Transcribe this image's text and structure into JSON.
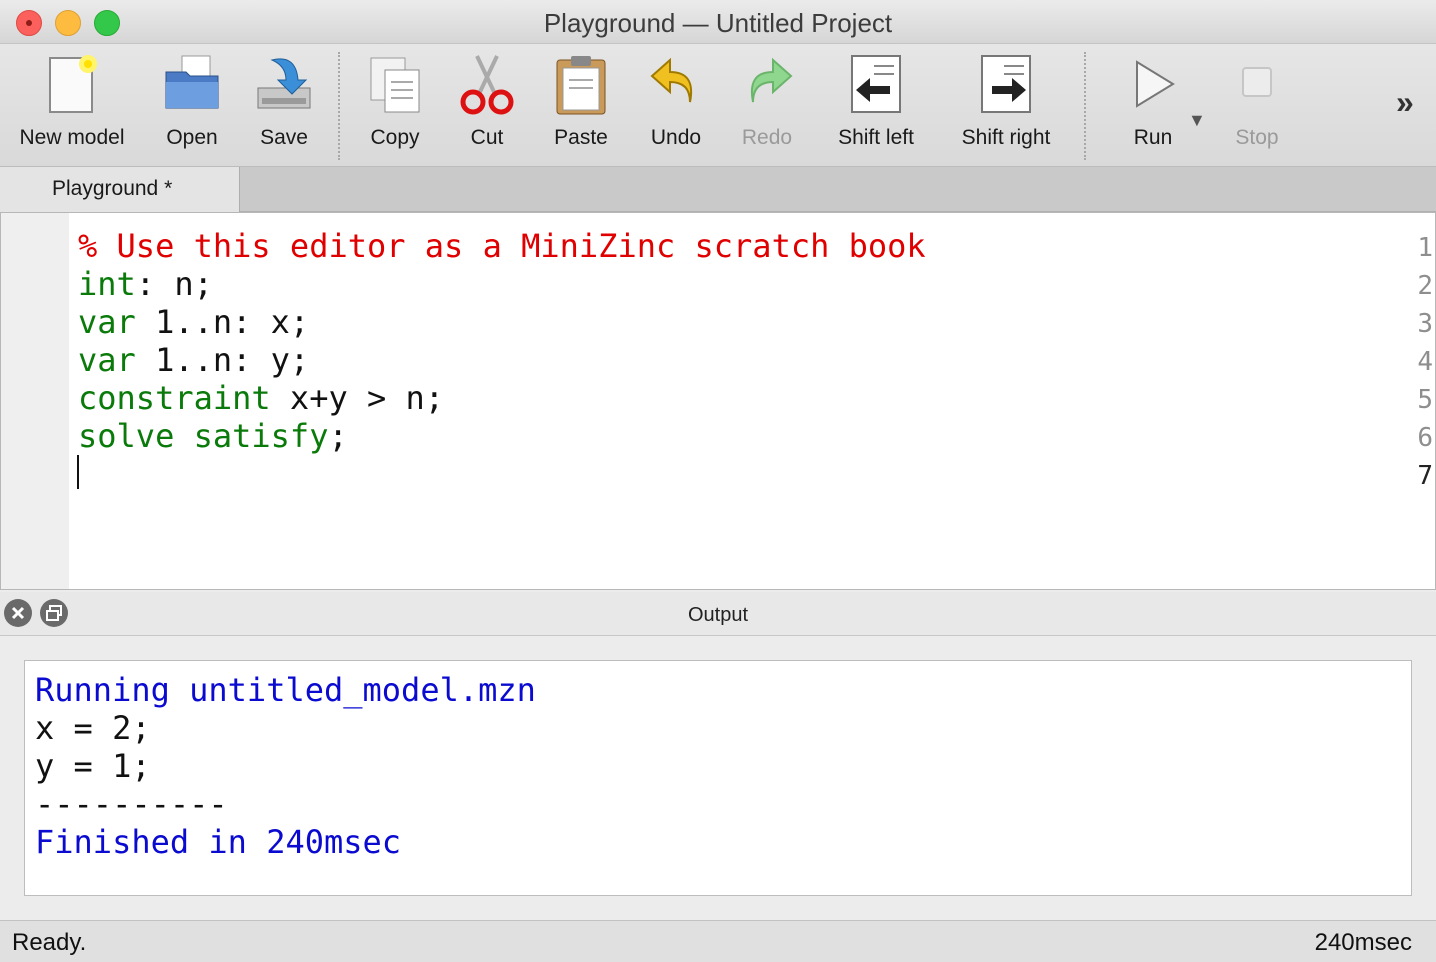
{
  "window": {
    "title": "Playground — Untitled Project"
  },
  "toolbar": {
    "new_model": "New model",
    "open": "Open",
    "save": "Save",
    "copy": "Copy",
    "cut": "Cut",
    "paste": "Paste",
    "undo": "Undo",
    "redo": "Redo",
    "shift_left": "Shift left",
    "shift_right": "Shift right",
    "run": "Run",
    "stop": "Stop",
    "overflow": "»"
  },
  "tabs": [
    {
      "label": "Playground *",
      "active": true
    }
  ],
  "editor": {
    "line_numbers": [
      "1",
      "2",
      "3",
      "4",
      "5",
      "6",
      "7"
    ],
    "lines": [
      {
        "parts": [
          {
            "text": "% Use this editor as a MiniZinc scratch book",
            "kind": "comment"
          }
        ]
      },
      {
        "parts": [
          {
            "text": "int",
            "kind": "keyword"
          },
          {
            "text": ": n;",
            "kind": "plain"
          }
        ]
      },
      {
        "parts": [
          {
            "text": "var",
            "kind": "keyword"
          },
          {
            "text": " 1..n: x;",
            "kind": "plain"
          }
        ]
      },
      {
        "parts": [
          {
            "text": "var",
            "kind": "keyword"
          },
          {
            "text": " 1..n: y;",
            "kind": "plain"
          }
        ]
      },
      {
        "parts": [
          {
            "text": "constraint",
            "kind": "keyword"
          },
          {
            "text": " x+y > n;",
            "kind": "plain"
          }
        ]
      },
      {
        "parts": [
          {
            "text": "solve satisfy",
            "kind": "keyword"
          },
          {
            "text": ";",
            "kind": "plain"
          }
        ]
      },
      {
        "parts": [
          {
            "text": "",
            "kind": "plain"
          }
        ]
      }
    ]
  },
  "output": {
    "title": "Output",
    "lines": [
      {
        "text": "Running untitled_model.mzn",
        "kind": "info"
      },
      {
        "text": "x = 2;",
        "kind": "plain"
      },
      {
        "text": "y = 1;",
        "kind": "plain"
      },
      {
        "text": "----------",
        "kind": "plain"
      },
      {
        "text": "Finished in 240msec",
        "kind": "info"
      }
    ]
  },
  "status": {
    "message": "Ready.",
    "time": "240msec"
  },
  "colors": {
    "keyword": "#0a7a0a",
    "comment": "#e00000",
    "info": "#0a0ad0"
  }
}
